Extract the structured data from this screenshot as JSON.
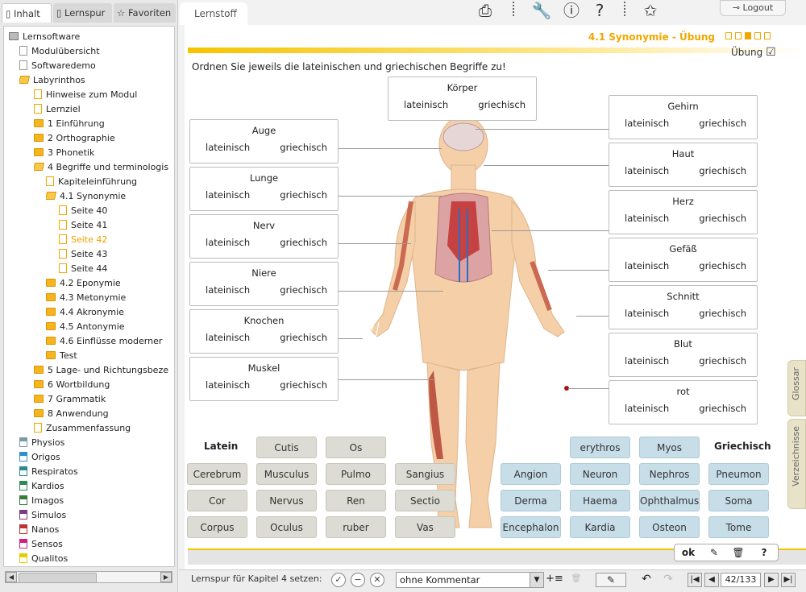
{
  "sidebar": {
    "tabs": [
      {
        "label": "Inhalt",
        "icon": "document-icon"
      },
      {
        "label": "Lernspur",
        "icon": "footprint-icon"
      },
      {
        "label": "Favoriten",
        "icon": "star-icon"
      }
    ],
    "tree": [
      {
        "label": "Lernsoftware",
        "icon": "folder-open-icon"
      },
      {
        "label": "Modulübersicht",
        "icon": "page-icon"
      },
      {
        "label": "Softwaredemo",
        "icon": "page-icon"
      },
      {
        "label": "Labyrinthos",
        "icon": "folder-open-icon"
      },
      {
        "label": "Hinweise zum Modul",
        "icon": "page-icon"
      },
      {
        "label": "Lernziel",
        "icon": "page-icon"
      },
      {
        "label": "1 Einführung",
        "icon": "folder-icon"
      },
      {
        "label": "2 Orthographie",
        "icon": "folder-icon"
      },
      {
        "label": "3 Phonetik",
        "icon": "folder-icon"
      },
      {
        "label": "4 Begriffe und terminologis",
        "icon": "folder-open-icon"
      },
      {
        "label": "Kapiteleinführung",
        "icon": "page-icon"
      },
      {
        "label": "4.1 Synonymie",
        "icon": "folder-open-icon"
      },
      {
        "label": "Seite 40",
        "icon": "page-icon"
      },
      {
        "label": "Seite 41",
        "icon": "page-icon"
      },
      {
        "label": "Seite 42",
        "icon": "page-icon"
      },
      {
        "label": "Seite 43",
        "icon": "page-icon"
      },
      {
        "label": "Seite 44",
        "icon": "page-icon"
      },
      {
        "label": "4.2 Eponymie",
        "icon": "folder-icon"
      },
      {
        "label": "4.3 Metonymie",
        "icon": "folder-icon"
      },
      {
        "label": "4.4 Akronymie",
        "icon": "folder-icon"
      },
      {
        "label": "4.5 Antonymie",
        "icon": "folder-icon"
      },
      {
        "label": "4.6 Einflüsse moderner",
        "icon": "folder-icon"
      },
      {
        "label": "Test",
        "icon": "folder-icon"
      },
      {
        "label": "5 Lage- und Richtungsbeze",
        "icon": "folder-icon"
      },
      {
        "label": "6 Wortbildung",
        "icon": "folder-icon"
      },
      {
        "label": "7 Grammatik",
        "icon": "folder-icon"
      },
      {
        "label": "8 Anwendung",
        "icon": "folder-icon"
      },
      {
        "label": "Zusammenfassung",
        "icon": "page-icon"
      },
      {
        "label": "Physios",
        "icon": "module-icon",
        "color": "#7a9aa8"
      },
      {
        "label": "Origos",
        "icon": "module-icon",
        "color": "#2b8fd4"
      },
      {
        "label": "Respiratos",
        "icon": "module-icon",
        "color": "#2a8a8f"
      },
      {
        "label": "Kardios",
        "icon": "module-icon",
        "color": "#2e8a55"
      },
      {
        "label": "Imagos",
        "icon": "module-icon",
        "color": "#3a7a3a"
      },
      {
        "label": "Simulos",
        "icon": "module-icon",
        "color": "#7a3a8a"
      },
      {
        "label": "Nanos",
        "icon": "module-icon",
        "color": "#c03030"
      },
      {
        "label": "Sensos",
        "icon": "module-icon",
        "color": "#d02080"
      },
      {
        "label": "Qualitos",
        "icon": "module-icon",
        "color": "#e0d000"
      }
    ],
    "selected_label": "Seite 42"
  },
  "toolbar": {
    "lernstoff_tab": "Lernstoff",
    "logout_label": "Logout",
    "icons": [
      "printer-icon",
      "wrench-icon",
      "info-icon",
      "help-icon",
      "add-favorite-icon"
    ]
  },
  "page": {
    "chapter_title": "4.1 Synonymie - Übung",
    "mode_label": "Übung",
    "instruction": "Ordnen Sie jeweils die lateinischen und griechischen Begriffe zu!"
  },
  "terms_left": [
    {
      "title": "Auge",
      "latin": "lateinisch",
      "greek": "griechisch"
    },
    {
      "title": "Lunge",
      "latin": "lateinisch",
      "greek": "griechisch"
    },
    {
      "title": "Nerv",
      "latin": "lateinisch",
      "greek": "griechisch"
    },
    {
      "title": "Niere",
      "latin": "lateinisch",
      "greek": "griechisch"
    },
    {
      "title": "Knochen",
      "latin": "lateinisch",
      "greek": "griechisch"
    },
    {
      "title": "Muskel",
      "latin": "lateinisch",
      "greek": "griechisch"
    }
  ],
  "term_top": {
    "title": "Körper",
    "latin": "lateinisch",
    "greek": "griechisch"
  },
  "terms_right": [
    {
      "title": "Gehirn",
      "latin": "lateinisch",
      "greek": "griechisch"
    },
    {
      "title": "Haut",
      "latin": "lateinisch",
      "greek": "griechisch"
    },
    {
      "title": "Herz",
      "latin": "lateinisch",
      "greek": "griechisch"
    },
    {
      "title": "Gefäß",
      "latin": "lateinisch",
      "greek": "griechisch"
    },
    {
      "title": "Schnitt",
      "latin": "lateinisch",
      "greek": "griechisch"
    },
    {
      "title": "Blut",
      "latin": "lateinisch",
      "greek": "griechisch"
    },
    {
      "title": "rot",
      "latin": "lateinisch",
      "greek": "griechisch"
    }
  ],
  "latin_heading": "Latein",
  "greek_heading": "Griechisch",
  "latin_words": [
    "Cutis",
    "Os",
    "Cerebrum",
    "Musculus",
    "Pulmo",
    "Sangius",
    "Cor",
    "Nervus",
    "Ren",
    "Sectio",
    "Corpus",
    "Oculus",
    "ruber",
    "Vas"
  ],
  "greek_words": [
    "erythros",
    "Myos",
    "Angion",
    "Neuron",
    "Nephros",
    "Pneumon",
    "Derma",
    "Haema",
    "Ophthalmus",
    "Soma",
    "Encephalon",
    "Kardia",
    "Osteon",
    "Tome"
  ],
  "side_tabs": [
    "Glossar",
    "Verzeichnisse"
  ],
  "action_bar": {
    "ok_label": "ok",
    "icons": [
      "check-edit-icon",
      "trash-icon",
      "help-icon"
    ]
  },
  "statusbar": {
    "lernspur_label": "Lernspur für Kapitel 4 setzen:",
    "comment_value": "ohne Kommentar",
    "page_indicator": "42/133"
  }
}
